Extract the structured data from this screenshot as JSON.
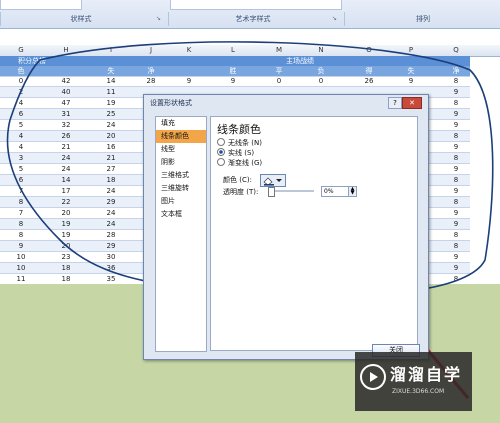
{
  "ribbon": {
    "group1": "状样式",
    "group2": "艺术字样式",
    "group3": "排列"
  },
  "columns": [
    "G",
    "H",
    "I",
    "J",
    "K",
    "L",
    "M",
    "N",
    "O",
    "P",
    "Q"
  ],
  "header_row1": {
    "left": "积分总榜",
    "right": "主场战绩"
  },
  "header_row2": [
    "色",
    "",
    "失",
    "净",
    "",
    "胜",
    "平",
    "负",
    "得",
    "失",
    "净"
  ],
  "rows": [
    [
      "0",
      "42",
      "14",
      "28",
      "9",
      "9",
      "0",
      "0",
      "26",
      "9",
      "8"
    ],
    [
      "2",
      "40",
      "11",
      "",
      "",
      "",
      "",
      "",
      "",
      "",
      "9"
    ],
    [
      "4",
      "47",
      "19",
      "",
      "",
      "",
      "",
      "",
      "",
      "",
      "8"
    ],
    [
      "6",
      "31",
      "25",
      "",
      "",
      "",
      "",
      "",
      "",
      "",
      "9"
    ],
    [
      "5",
      "32",
      "24",
      "",
      "",
      "",
      "",
      "",
      "",
      "",
      "9"
    ],
    [
      "4",
      "26",
      "20",
      "",
      "",
      "",
      "",
      "",
      "",
      "",
      "8"
    ],
    [
      "4",
      "21",
      "16",
      "",
      "",
      "",
      "",
      "",
      "",
      "",
      "9"
    ],
    [
      "3",
      "24",
      "21",
      "",
      "",
      "",
      "",
      "",
      "",
      "",
      "8"
    ],
    [
      "5",
      "24",
      "27",
      "",
      "",
      "",
      "",
      "",
      "",
      "",
      "9"
    ],
    [
      "6",
      "14",
      "18",
      "",
      "",
      "",
      "",
      "",
      "",
      "",
      "8"
    ],
    [
      "7",
      "17",
      "24",
      "",
      "",
      "",
      "",
      "",
      "",
      "",
      "9"
    ],
    [
      "8",
      "22",
      "29",
      "",
      "",
      "",
      "",
      "",
      "",
      "",
      "8"
    ],
    [
      "7",
      "20",
      "24",
      "",
      "",
      "",
      "",
      "",
      "",
      "",
      "9"
    ],
    [
      "8",
      "19",
      "24",
      "",
      "",
      "",
      "",
      "",
      "",
      "",
      "9"
    ],
    [
      "8",
      "19",
      "28",
      "",
      "",
      "",
      "",
      "",
      "",
      "",
      "8"
    ],
    [
      "9",
      "20",
      "29",
      "",
      "",
      "",
      "",
      "",
      "",
      "",
      "8"
    ],
    [
      "10",
      "23",
      "30",
      "",
      "",
      "",
      "",
      "",
      "",
      "",
      "9"
    ],
    [
      "10",
      "18",
      "36",
      "",
      "",
      "",
      "",
      "",
      "",
      "",
      "9"
    ],
    [
      "11",
      "18",
      "35",
      "",
      "",
      "",
      "",
      "",
      "",
      "",
      "8"
    ],
    [
      "9",
      "9",
      "32",
      "",
      "",
      "",
      "",
      "",
      "",
      "",
      "8"
    ]
  ],
  "dialog": {
    "title": "设置形状格式",
    "help": "?",
    "close_x": "✕",
    "nav": [
      "填充",
      "线条颜色",
      "线型",
      "阴影",
      "三维格式",
      "三维旋转",
      "图片",
      "文本框"
    ],
    "section_title": "线条颜色",
    "options": [
      "无线条 (N)",
      "实线 (S)",
      "渐变线 (G)"
    ],
    "color_label": "颜色 (C):",
    "transparency_label": "透明度 (T):",
    "transparency_value": "0%",
    "close_button": "关闭"
  },
  "watermark": {
    "title": "溜溜自学",
    "url": "ZIXUE.3D66.COM"
  },
  "colors": {
    "accent": "#f3a649",
    "header": "#5b8fd6",
    "annotation": "#e01b1b"
  }
}
